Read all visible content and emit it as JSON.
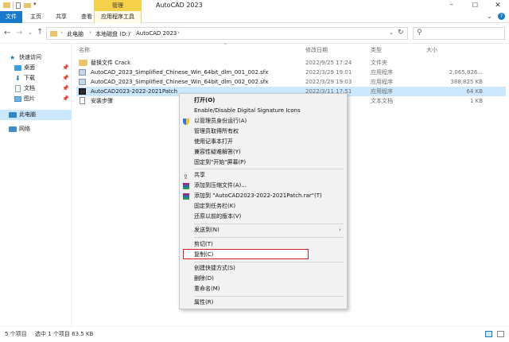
{
  "window": {
    "ribbon_context_label": "管理",
    "title": "AutoCAD 2023",
    "tabs": [
      "文件",
      "主页",
      "共享",
      "查看",
      "应用程序工具"
    ]
  },
  "address": {
    "crumbs": [
      "此电脑",
      "本地磁盘 (D:)",
      "AutoCAD 2023"
    ]
  },
  "nav": {
    "items": [
      {
        "label": "快速访问",
        "icon": "star-icon"
      },
      {
        "label": "桌面",
        "icon": "desktop-icon"
      },
      {
        "label": "下载",
        "icon": "download-icon"
      },
      {
        "label": "文档",
        "icon": "document-icon"
      },
      {
        "label": "图片",
        "icon": "picture-icon"
      },
      {
        "label": "此电脑",
        "icon": "computer-icon"
      },
      {
        "label": "网络",
        "icon": "network-icon"
      }
    ]
  },
  "list": {
    "columns": [
      "名称",
      "修改日期",
      "类型",
      "大小"
    ],
    "rows": [
      {
        "name": "替换文件 Crack",
        "date": "2022/9/25 17:24",
        "type": "文件夹",
        "size": "",
        "icon": "folder-icon"
      },
      {
        "name": "AutoCAD_2023_Simplified_Chinese_Win_64bit_dlm_001_002.sfx",
        "date": "2022/3/29 19:01",
        "type": "应用程序",
        "size": "2,065,826...",
        "icon": "sfx-icon"
      },
      {
        "name": "AutoCAD_2023_Simplified_Chinese_Win_64bit_dlm_002_002.sfx",
        "date": "2022/3/29 19:03",
        "type": "应用程序",
        "size": "388,825 KB",
        "icon": "sfx-icon"
      },
      {
        "name": "AutoCAD2023-2022-2021Patch",
        "date": "2022/3/11 17:51",
        "type": "应用程序",
        "size": "64 KB",
        "icon": "exe-icon"
      },
      {
        "name": "安装步骤",
        "date": "",
        "type": "文本文档",
        "size": "1 KB",
        "icon": "text-file-icon"
      }
    ]
  },
  "context_menu": {
    "items": [
      {
        "label": "打开(O)",
        "bold": true,
        "icon": ""
      },
      {
        "label": "Enable/Disable Digital Signature Icons",
        "icon": ""
      },
      {
        "label": "以管理员身份运行(A)",
        "icon": "shield-icon"
      },
      {
        "label": "管理员取得所有权",
        "icon": ""
      },
      {
        "label": "使用记事本打开",
        "icon": ""
      },
      {
        "label": "兼容性疑难解答(Y)",
        "icon": ""
      },
      {
        "label": "固定到\"开始\"屏幕(P)",
        "icon": ""
      },
      {
        "label": "共享",
        "icon": "share-icon"
      },
      {
        "label": "添加到压缩文件(A)...",
        "icon": "archive-icon"
      },
      {
        "label": "添加到 \"AutoCAD2023-2022-2021Patch.rar\"(T)",
        "icon": "archive-icon"
      },
      {
        "label": "固定到任务栏(K)",
        "icon": ""
      },
      {
        "label": "还原以前的版本(V)",
        "icon": ""
      },
      {
        "label": "发送到(N)",
        "icon": "",
        "submenu": true
      },
      {
        "label": "剪切(T)",
        "icon": ""
      },
      {
        "label": "复制(C)",
        "icon": "",
        "highlighted": true
      },
      {
        "label": "创建快捷方式(S)",
        "icon": ""
      },
      {
        "label": "删除(D)",
        "icon": ""
      },
      {
        "label": "重命名(M)",
        "icon": ""
      },
      {
        "label": "属性(R)",
        "icon": ""
      }
    ]
  },
  "status": {
    "item_count": "5 个项目",
    "selection": "选中 1 个项目  63.5 KB"
  },
  "colors": {
    "accent": "#1979ca",
    "ribbon_context": "#f4d04b",
    "selection_bg": "#cce8ff",
    "highlight_border": "#e02020"
  }
}
